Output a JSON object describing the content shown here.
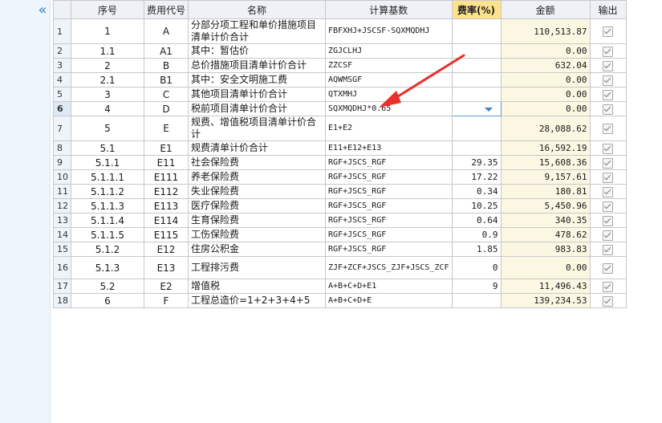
{
  "columns": {
    "seq": "序号",
    "code": "费用代号",
    "name": "名称",
    "base": "计算基数",
    "rate": "费率(%)",
    "amount": "金额",
    "output": "输出"
  },
  "rows": [
    {
      "n": "1",
      "seq": "1",
      "code": "A",
      "name": "分部分项工程和单价措施项目清单计价合计",
      "base": "FBFXHJ+JSCSF-SQXMQDHJ",
      "rate": "",
      "amount": "110,513.87",
      "tall": true
    },
    {
      "n": "2",
      "seq": "1.1",
      "code": "A1",
      "name": "其中：暂估价",
      "base": "ZGJCLHJ",
      "rate": "",
      "amount": "0.00"
    },
    {
      "n": "3",
      "seq": "2",
      "code": "B",
      "name": "总价措施项目清单计价合计",
      "base": "ZZCSF",
      "rate": "",
      "amount": "632.04"
    },
    {
      "n": "4",
      "seq": "2.1",
      "code": "B1",
      "name": "其中：安全文明施工费",
      "base": "AQWMSGF",
      "rate": "",
      "amount": "0.00"
    },
    {
      "n": "5",
      "seq": "3",
      "code": "C",
      "name": "其他项目清单计价合计",
      "base": "QTXMHJ",
      "rate": "",
      "amount": "0.00"
    },
    {
      "n": "6",
      "seq": "4",
      "code": "D",
      "name": "税前项目清单计价合计",
      "base": "SQXMQDHJ*0.65",
      "rate": "",
      "amount": "0.00",
      "selected": true
    },
    {
      "n": "7",
      "seq": "5",
      "code": "E",
      "name": "规费、增值税项目清单计价合计",
      "base": "E1+E2",
      "rate": "",
      "amount": "28,088.62",
      "tall": true
    },
    {
      "n": "8",
      "seq": "5.1",
      "code": "E1",
      "name": "规费清单计价合计",
      "base": "E11+E12+E13",
      "rate": "",
      "amount": "16,592.19"
    },
    {
      "n": "9",
      "seq": "5.1.1",
      "code": "E11",
      "name": "社会保险费",
      "base": "RGF+JSCS_RGF",
      "rate": "29.35",
      "amount": "15,608.36"
    },
    {
      "n": "10",
      "seq": "5.1.1.1",
      "code": "E111",
      "name": "养老保险费",
      "base": "RGF+JSCS_RGF",
      "rate": "17.22",
      "amount": "9,157.61"
    },
    {
      "n": "11",
      "seq": "5.1.1.2",
      "code": "E112",
      "name": "失业保险费",
      "base": "RGF+JSCS_RGF",
      "rate": "0.34",
      "amount": "180.81"
    },
    {
      "n": "12",
      "seq": "5.1.1.3",
      "code": "E113",
      "name": "医疗保险费",
      "base": "RGF+JSCS_RGF",
      "rate": "10.25",
      "amount": "5,450.96"
    },
    {
      "n": "13",
      "seq": "5.1.1.4",
      "code": "E114",
      "name": "生育保险费",
      "base": "RGF+JSCS_RGF",
      "rate": "0.64",
      "amount": "340.35"
    },
    {
      "n": "14",
      "seq": "5.1.1.5",
      "code": "E115",
      "name": "工伤保险费",
      "base": "RGF+JSCS_RGF",
      "rate": "0.9",
      "amount": "478.62"
    },
    {
      "n": "15",
      "seq": "5.1.2",
      "code": "E12",
      "name": "住房公积金",
      "base": "RGF+JSCS_RGF",
      "rate": "1.85",
      "amount": "983.83"
    },
    {
      "n": "16",
      "seq": "5.1.3",
      "code": "E13",
      "name": "工程排污费",
      "base": "ZJF+ZCF+JSCS_ZJF+JSCS_ZCF",
      "rate": "0",
      "amount": "0.00",
      "tall": true
    },
    {
      "n": "17",
      "seq": "5.2",
      "code": "E2",
      "name": "增值税",
      "base": "A+B+C+D+E1",
      "rate": "9",
      "amount": "11,496.43"
    },
    {
      "n": "18",
      "seq": "6",
      "code": "F",
      "name": "工程总造价=1+2+3+4+5",
      "base": "A+B+C+D+E",
      "rate": "",
      "amount": "139,234.53"
    }
  ],
  "colors": {
    "rate_header": "#fce28c",
    "amount_bg": "#fbf7e3",
    "arrow": "#e8312b",
    "selection": "#5b9bd5"
  },
  "icons": {
    "collapse": "double-chevron-left-icon",
    "checkbox": "checked-checkbox-icon",
    "dropdown": "dropdown-arrow-icon",
    "annotation": "red-arrow-annotation"
  }
}
